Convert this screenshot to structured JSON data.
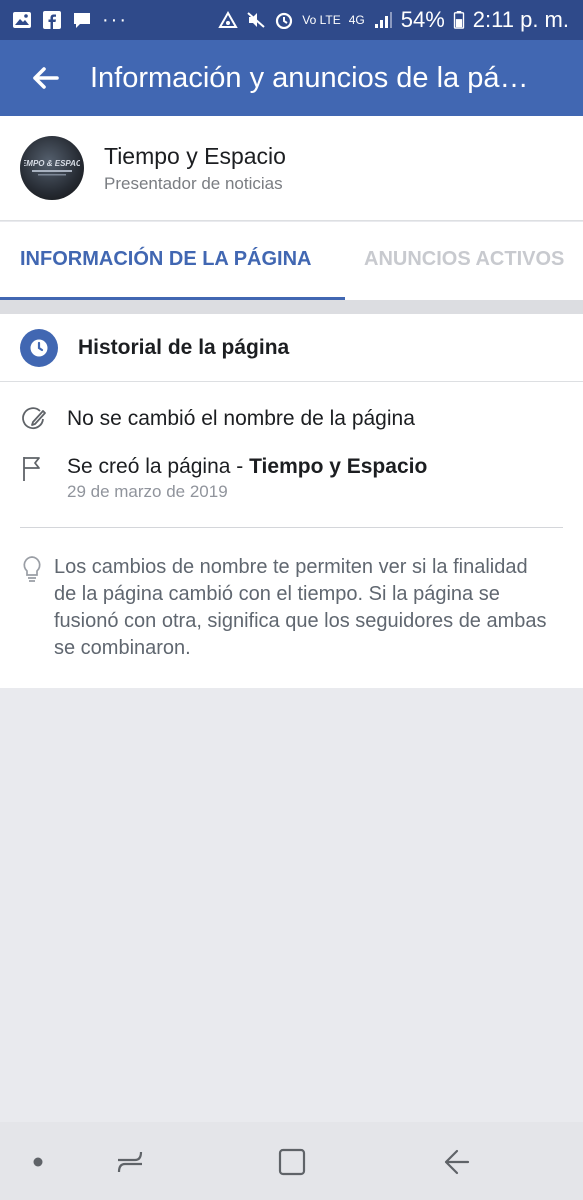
{
  "status_bar": {
    "battery": "54%",
    "time": "2:11 p. m.",
    "network": "4G",
    "volte": "Vo LTE"
  },
  "header": {
    "title": "Información y anuncios de la página"
  },
  "page": {
    "name": "Tiempo y Espacio",
    "category": "Presentador de noticias",
    "avatar_text": "TIEMPO & ESPACIO"
  },
  "tabs": [
    {
      "label": "INFORMACIÓN DE LA PÁGINA",
      "active": true
    },
    {
      "label": "ANUNCIOS ACTIVOS",
      "active": false
    }
  ],
  "history": {
    "title": "Historial de la página",
    "items": [
      {
        "text": "No se cambió el nombre de la página"
      },
      {
        "prefix": "Se creó la página - ",
        "bold": "Tiempo y Espacio",
        "date": "29 de marzo de 2019"
      }
    ],
    "info": "Los cambios de nombre te permiten ver si la finalidad de la página cambió con el tiempo. Si la página se fusionó con otra, significa que los seguidores de ambas se combinaron."
  },
  "colors": {
    "status_bar": "#2f4a8a",
    "header": "#4167b2",
    "accent": "#4167b2",
    "inactive_tab": "#c8cacf",
    "background": "#e9eaee"
  },
  "icons": {
    "back": "arrow-left-icon",
    "clock": "clock-icon",
    "rename": "pencil-circle-icon",
    "created": "flag-icon",
    "info": "lightbulb-icon"
  }
}
